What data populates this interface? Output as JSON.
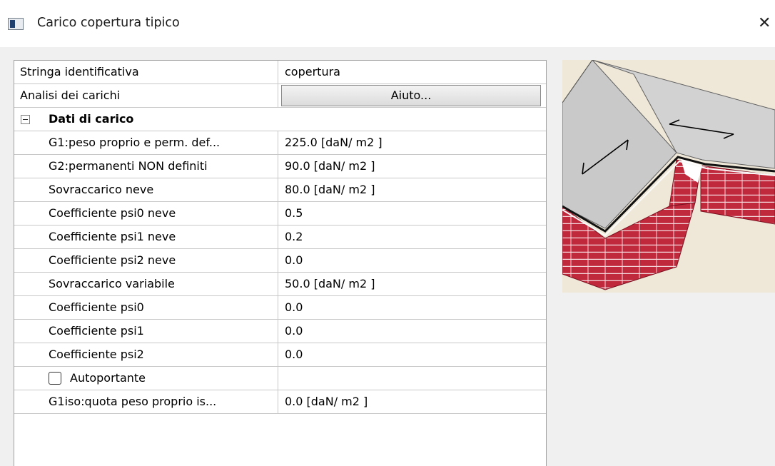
{
  "window": {
    "title": "Carico copertura tipico",
    "close_glyph": "✕"
  },
  "grid": {
    "id_row": {
      "label": "Stringa identificativa",
      "value": "copertura"
    },
    "analysis_row": {
      "label": "Analisi dei carichi",
      "button_label": "Aiuto..."
    },
    "group": {
      "label": "Dati di carico",
      "expander_state": "expanded"
    },
    "items": [
      {
        "label": "G1:peso proprio e perm. def...",
        "value": "225.0  [daN/ m2 ]"
      },
      {
        "label": "G2:permanenti NON definiti",
        "value": "90.0  [daN/ m2 ]"
      },
      {
        "label": "Sovraccarico neve",
        "value": "80.0  [daN/ m2 ]"
      },
      {
        "label": "Coefficiente psi0 neve",
        "value": "0.5"
      },
      {
        "label": "Coefficiente psi1 neve",
        "value": "0.2"
      },
      {
        "label": "Coefficiente psi2 neve",
        "value": "0.0"
      },
      {
        "label": "Sovraccarico variabile",
        "value": "50.0  [daN/ m2 ]"
      },
      {
        "label": "Coefficiente psi0",
        "value": "0.0"
      },
      {
        "label": "Coefficiente psi1",
        "value": "0.0"
      },
      {
        "label": "Coefficiente psi2",
        "value": "0.0"
      }
    ],
    "autoportante": {
      "label": "Autoportante",
      "checked": false,
      "value": ""
    },
    "last_row": {
      "label": "G1iso:quota peso proprio is...",
      "value": "0.0  [daN/ m2 ]"
    }
  },
  "preview": {
    "icon": "roof-load-illustration-icon",
    "colors": {
      "roof": "#d4d4d4",
      "brick": "#c0283c",
      "background": "#efe8d8"
    }
  }
}
